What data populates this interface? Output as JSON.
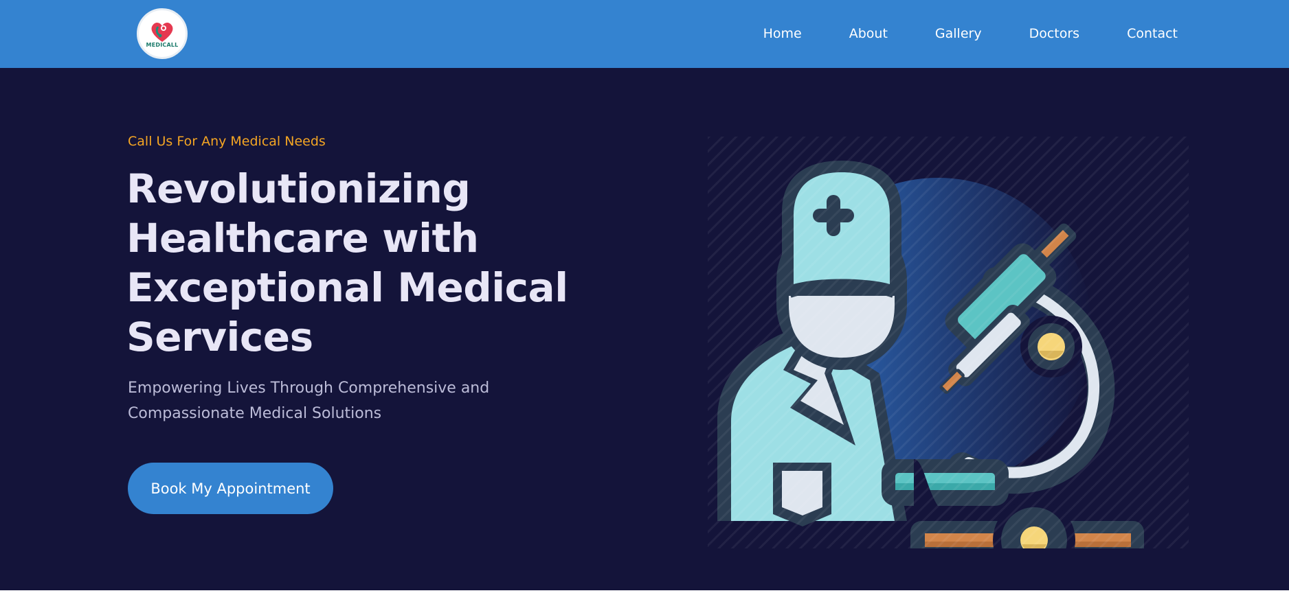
{
  "header": {
    "logo_text": "MEDICALL",
    "nav": [
      {
        "label": "Home",
        "active": true
      },
      {
        "label": "About",
        "active": false
      },
      {
        "label": "Gallery",
        "active": false
      },
      {
        "label": "Doctors",
        "active": false
      },
      {
        "label": "Contact",
        "active": false
      }
    ]
  },
  "hero": {
    "tagline": "Call Us For Any Medical Needs",
    "headline": "Revolutionizing Healthcare with Exceptional Medical Services",
    "subtitle": "Empowering Lives Through Comprehensive and Compassionate Medical Solutions",
    "cta_label": "Book My Appointment",
    "illustration": "doctor-with-microscope-illustration"
  },
  "colors": {
    "header_bg": "#3483d0",
    "hero_bg": "#14143a",
    "accent": "#f5a623",
    "headline": "#e8e6f6",
    "button": "#3483d0"
  }
}
